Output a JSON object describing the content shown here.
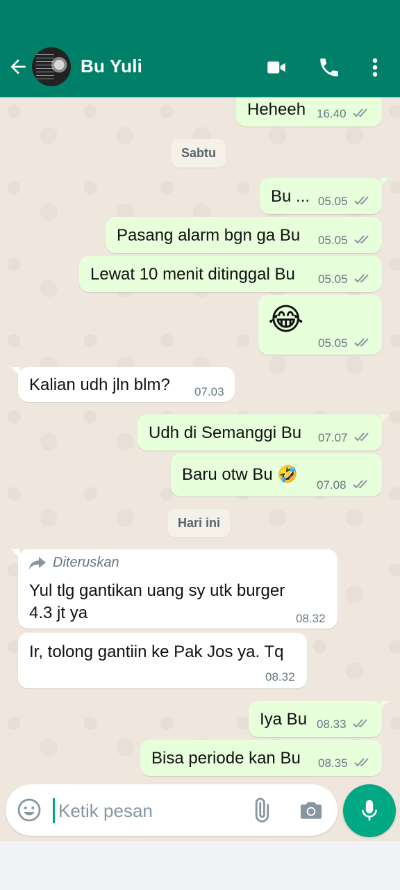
{
  "header": {
    "contact_name": "Bu Yuli",
    "icons": [
      "back-arrow-icon",
      "avatar",
      "video-call-icon",
      "voice-call-icon",
      "menu-dots-icon"
    ],
    "bg_color": "#008069"
  },
  "date_chips": {
    "saturday": "Sabtu",
    "today": "Hari ini"
  },
  "messages": [
    {
      "dir": "out",
      "text": "Heheeh",
      "time": "16.40",
      "status": "read"
    },
    {
      "dir": "out",
      "text": "Bu ...",
      "time": "05.05",
      "status": "read"
    },
    {
      "dir": "out",
      "text": "Pasang alarm bgn ga Bu",
      "time": "05.05",
      "status": "read"
    },
    {
      "dir": "out",
      "text": "Lewat 10 menit ditinggal Bu",
      "time": "05.05",
      "status": "read"
    },
    {
      "dir": "out",
      "text": "😂",
      "time": "05.05",
      "status": "read"
    },
    {
      "dir": "in",
      "text": "Kalian udh jln blm?",
      "time": "07.03"
    },
    {
      "dir": "out",
      "text": "Udh di Semanggi Bu",
      "time": "07.07",
      "status": "read"
    },
    {
      "dir": "out",
      "text": "Baru otw Bu 🤣",
      "time": "07.08",
      "status": "read"
    },
    {
      "dir": "in",
      "forwarded_label": "Diteruskan",
      "text_line1": "Yul tlg gantikan uang sy utk burger",
      "text_line2": "4.3 jt ya",
      "time": "08.32"
    },
    {
      "dir": "in",
      "text": "Ir, tolong gantiin ke Pak Jos ya. Tq",
      "time": "08.32"
    },
    {
      "dir": "out",
      "text": "Iya Bu",
      "time": "08.33",
      "status": "read"
    },
    {
      "dir": "out",
      "text": "Bisa periode kan Bu",
      "time": "08.35",
      "status": "read"
    }
  ],
  "composer": {
    "placeholder": "Ketik pesan",
    "icons": [
      "emoji-icon",
      "attach-icon",
      "camera-icon",
      "mic-icon"
    ]
  },
  "colors": {
    "outgoing_bubble": "#e7ffdb",
    "incoming_bubble": "#ffffff",
    "chat_bg": "#efe7dd",
    "accent": "#00a884",
    "read_ticks": "#8696a0"
  }
}
